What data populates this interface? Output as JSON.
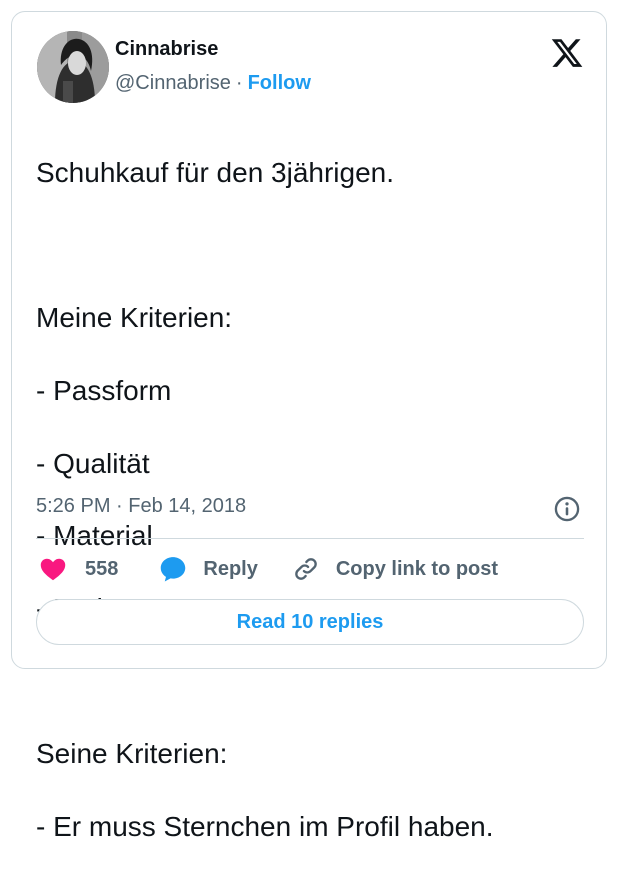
{
  "author": {
    "name": "Cinnabrise",
    "handle": "@Cinnabrise",
    "separator": "·",
    "follow_label": "Follow"
  },
  "tweet": {
    "lines": [
      "Schuhkauf für den 3jährigen.",
      "",
      "Meine Kriterien:",
      "- Passform",
      "- Qualität",
      "- Material",
      "- Preis",
      "",
      "Seine Kriterien:",
      "- Er muss Sternchen im Profil haben."
    ],
    "timestamp": "5:26 PM · Feb 14, 2018"
  },
  "actions": {
    "like_count": "558",
    "reply_label": "Reply",
    "copy_label": "Copy link to post"
  },
  "read_replies_label": "Read 10 replies",
  "icons": {
    "logo": "x-logo-icon",
    "info": "info-icon",
    "like": "heart-icon",
    "reply": "speech-bubble-icon",
    "copy": "link-icon"
  },
  "colors": {
    "accent": "#1d9bf0",
    "heart": "#f91880",
    "text": "#0f1419",
    "secondary": "#536471",
    "border": "#cfd9de"
  }
}
